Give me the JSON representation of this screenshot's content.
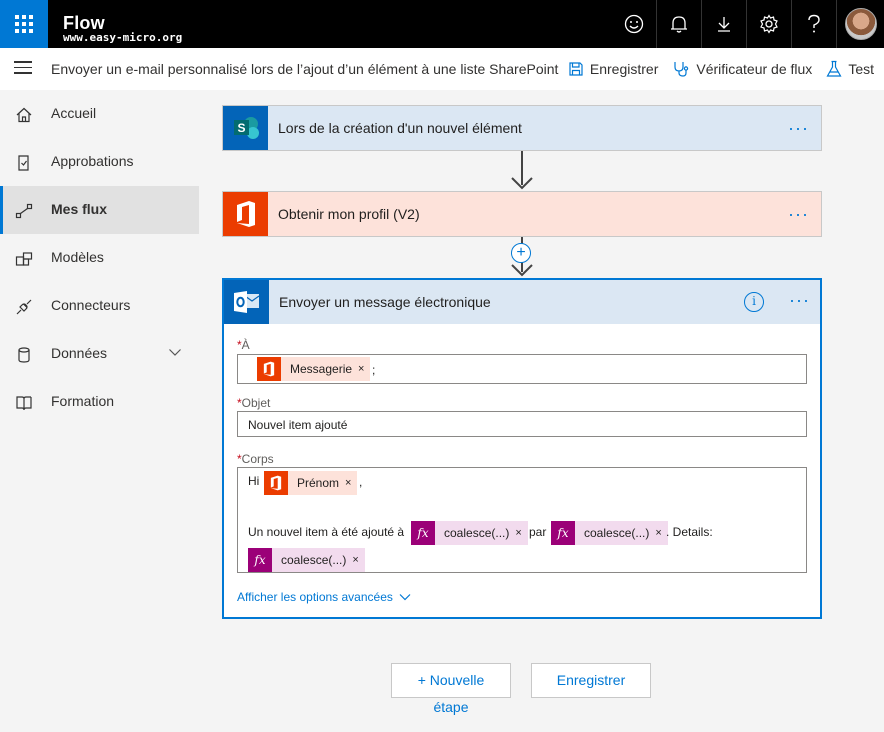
{
  "header": {
    "app_name": "Flow",
    "subtitle": "www.easy-micro.org",
    "icons": [
      "waffle-icon",
      "smiley-icon",
      "bell-icon",
      "download-icon",
      "gear-icon",
      "help-icon",
      "avatar"
    ]
  },
  "commandbar": {
    "flow_title": "Envoyer un e-mail personnalisé lors de l’ajout d’un élément à une liste SharePoint",
    "save_label": "Enregistrer",
    "checker_label": "Vérificateur de flux",
    "test_label": "Test"
  },
  "sidebar": {
    "items": [
      {
        "label": "Accueil",
        "icon": "home-icon"
      },
      {
        "label": "Approbations",
        "icon": "approvals-icon"
      },
      {
        "label": "Mes flux",
        "icon": "flows-icon",
        "active": true
      },
      {
        "label": "Modèles",
        "icon": "templates-icon"
      },
      {
        "label": "Connecteurs",
        "icon": "connectors-icon"
      },
      {
        "label": "Données",
        "icon": "database-icon"
      },
      {
        "label": "Formation",
        "icon": "book-icon"
      }
    ]
  },
  "steps": {
    "trigger": {
      "title": "Lors de la création d'un nouvel élément",
      "more": "···"
    },
    "profile": {
      "title": "Obtenir mon profil (V2)",
      "more": "···"
    },
    "email": {
      "title": "Envoyer un message électronique",
      "more": "···",
      "info": "i",
      "to_label": "À",
      "to_token": "Messagerie",
      "to_suffix": ";",
      "subject_label": "Objet",
      "subject_value": "Nouvel item ajouté",
      "body_label": "Corps",
      "body_hi": "Hi",
      "body_firstname_token": "Prénom",
      "body_comma": ",",
      "body_line2_prefix": "Un nouvel item à été ajouté à",
      "body_coalesce1": "coalesce(...)",
      "body_par": "par",
      "body_coalesce2": "coalesce(...)",
      "body_details": ". Details:",
      "body_coalesce3": "coalesce(...)",
      "fx_label": "fx",
      "advanced_link": "Afficher les options avancées",
      "required_mark": "*",
      "token_remove": "×"
    }
  },
  "footer": {
    "new_step_label_1": "+ Nouvelle",
    "new_step_label_2": "étape",
    "save_label": "Enregistrer"
  },
  "colors": {
    "accent": "#0078d4",
    "sharepoint": "#0364b8",
    "office365": "#eb3c00",
    "expression": "#9b0078"
  }
}
